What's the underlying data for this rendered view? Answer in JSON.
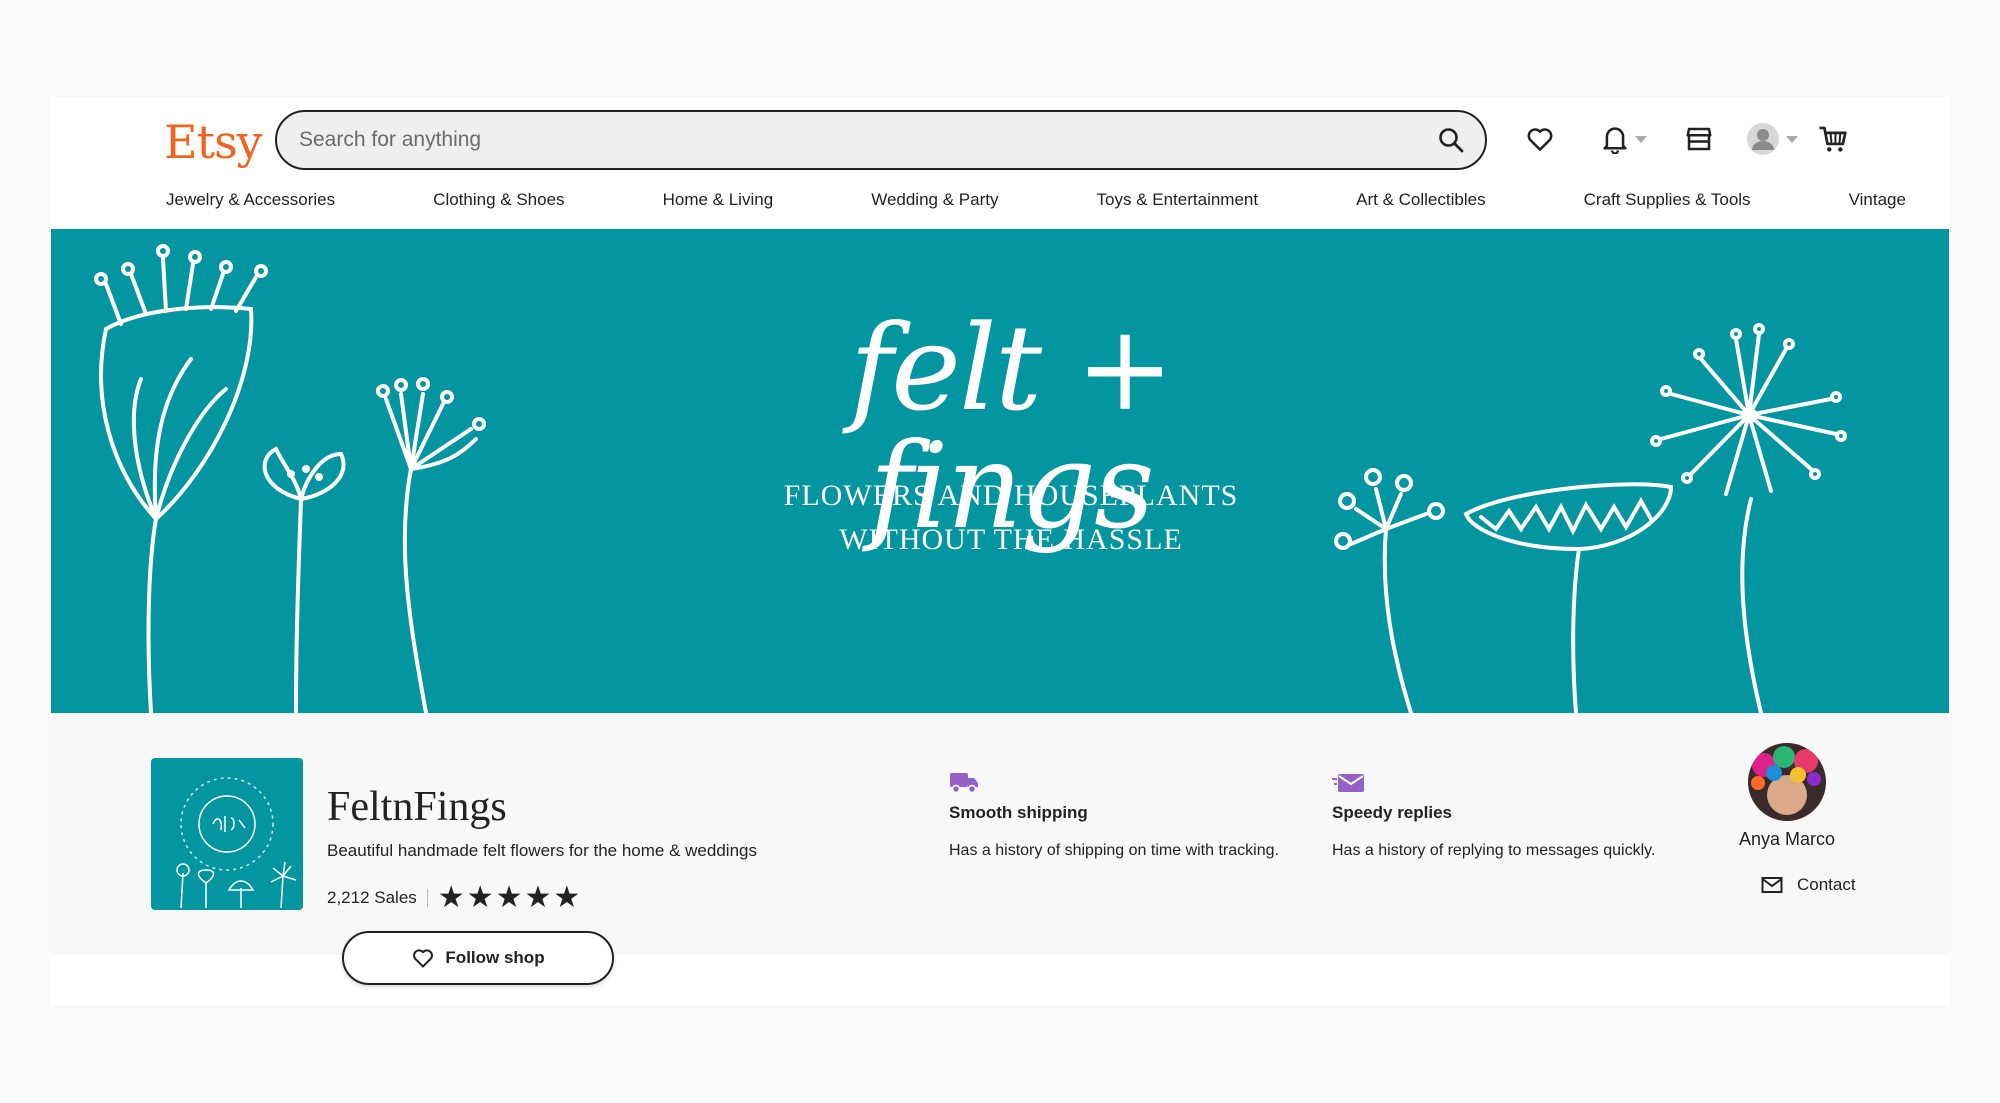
{
  "header": {
    "logo": "Etsy",
    "search_placeholder": "Search for anything"
  },
  "icons": [
    "search-icon",
    "heart-icon",
    "bell-icon",
    "shop-icon",
    "account-icon",
    "cart-icon"
  ],
  "categories": [
    "Jewelry & Accessories",
    "Clothing & Shoes",
    "Home & Living",
    "Wedding & Party",
    "Toys & Entertainment",
    "Art & Collectibles",
    "Craft Supplies & Tools",
    "Vintage"
  ],
  "banner": {
    "title": "felt + fings",
    "subtitle_line1": "FLOWERS AND HOUSEPLANTS",
    "subtitle_line2": "WITHOUT THE HASSLE",
    "background_color": "#0396a0"
  },
  "shop": {
    "name": "FeltnFings",
    "tagline": "Beautiful handmade felt flowers for the home & weddings",
    "sales": "2,212 Sales",
    "rating_stars": 5,
    "follow_label": "Follow shop"
  },
  "features": [
    {
      "title": "Smooth shipping",
      "description": "Has a history of shipping on time with tracking."
    },
    {
      "title": "Speedy replies",
      "description": "Has a history of replying to messages quickly."
    }
  ],
  "owner": {
    "name": "Anya Marco",
    "contact_label": "Contact"
  },
  "colors": {
    "brand_orange": "#f1641e",
    "banner_teal": "#0396a0",
    "feature_purple": "#9560c8"
  }
}
